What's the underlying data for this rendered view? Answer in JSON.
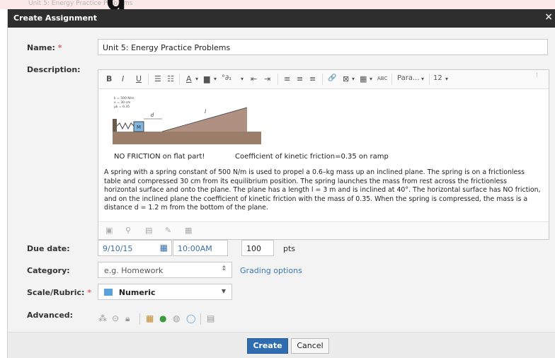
{
  "background": {
    "faint_text": "Unit 5: Energy Practice Problems",
    "big_text": "g"
  },
  "dialog": {
    "title": "Create Assignment",
    "close": "×"
  },
  "form": {
    "name_label": "Name:",
    "name_required": "*",
    "name_value": "Unit 5: Energy Practice Problems",
    "description_label": "Description:",
    "toolbar": {
      "bold": "B",
      "italic": "I",
      "underline": "U",
      "bullets": "☰",
      "numbers": "☷",
      "font_color": "A",
      "highlight": "▆",
      "symbol": "°∂₁",
      "indent_out": "⇤",
      "indent_in": "⇥",
      "align_left": "≡",
      "align_center": "≡",
      "align_right": "≡",
      "link": "🔗",
      "media": "⊠",
      "table": "▦",
      "spell": "ABC",
      "paragraph": "Para...",
      "font_size": "12"
    },
    "figure_labels": [
      "k = 500 N/m",
      "x = 30 cm",
      "μk = 0.35"
    ],
    "figure_letters": {
      "mass": "M",
      "d": "d",
      "l": "l"
    },
    "caption_left": "NO FRICTION on flat part!",
    "caption_right": "Coefficient of kinetic friction=0.35 on ramp",
    "description_text": "A spring with a spring constant of 500 N/m is used to propel a 0.6–kg mass up an inclined plane. The spring is on a frictionless table and compressed 30 cm from its equilibrium position. The spring launches the mass from rest across the frictionless horizontal surface and onto the plane. The plane has a length l = 3 m and is inclined at 40°. The horizontal surface has NO friction, and on the inclined plane the coefficient of kinetic friction with the mass of 0.35. When the spring is compressed, the mass is a distance d = 1.2 m from the bottom of the plane.",
    "due_label": "Due date:",
    "due_date": "9/10/15",
    "due_time": "10:00AM",
    "points_value": "100",
    "points_unit": "pts",
    "category_label": "Category:",
    "category_placeholder": "e.g. Homework",
    "grading_options": "Grading options",
    "scale_label": "Scale/Rubric:",
    "scale_required": "*",
    "scale_value": "Numeric",
    "advanced_label": "Advanced:"
  },
  "footer": {
    "create": "Create",
    "cancel": "Cancel"
  },
  "colors": {
    "title_bar": "#2e2e2e",
    "accent": "#2f6db0",
    "link": "#3c78b8",
    "required": "#e06666"
  }
}
